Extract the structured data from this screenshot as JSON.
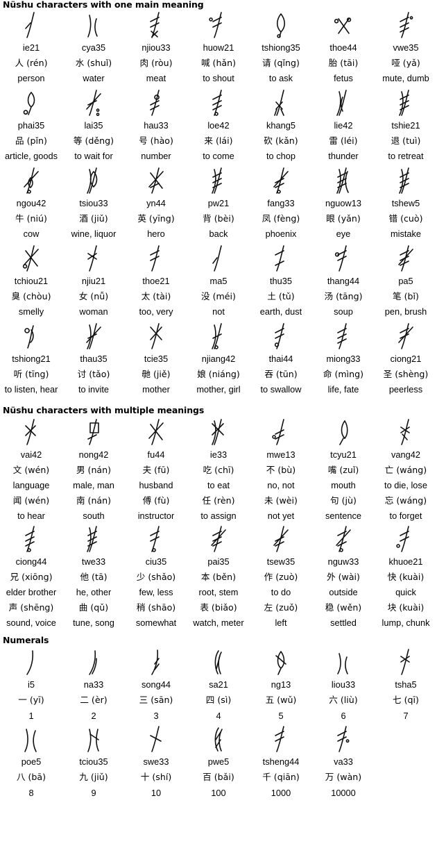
{
  "sections": [
    {
      "id": "one-meaning",
      "title": "Nüshu characters with one main meaning",
      "rows_per_entry": [
        "romanization",
        "hanzi",
        "meaning"
      ],
      "entries": [
        {
          "glyph": "nushu-glyph-ie21",
          "romanization": "ie21",
          "hanzi": "人 (rén)",
          "meaning": "person"
        },
        {
          "glyph": "nushu-glyph-cya35",
          "romanization": "cya35",
          "hanzi": "水 (shuǐ)",
          "meaning": "water"
        },
        {
          "glyph": "nushu-glyph-njiou33",
          "romanization": "njiou33",
          "hanzi": "肉 (ròu)",
          "meaning": "meat"
        },
        {
          "glyph": "nushu-glyph-huow21",
          "romanization": "huow21",
          "hanzi": "喊 (hǎn)",
          "meaning": "to shout"
        },
        {
          "glyph": "nushu-glyph-tshiong35",
          "romanization": "tshiong35",
          "hanzi": "请 (qǐng)",
          "meaning": "to ask"
        },
        {
          "glyph": "nushu-glyph-thoe44",
          "romanization": "thoe44",
          "hanzi": "胎 (tāi)",
          "meaning": "fetus"
        },
        {
          "glyph": "nushu-glyph-vwe35",
          "romanization": "vwe35",
          "hanzi": "哑 (yǎ)",
          "meaning": "mute, dumb"
        },
        {
          "glyph": "nushu-glyph-phai35",
          "romanization": "phai35",
          "hanzi": "品 (pǐn)",
          "meaning": "article, goods"
        },
        {
          "glyph": "nushu-glyph-lai35",
          "romanization": "lai35",
          "hanzi": "等 (děng)",
          "meaning": "to wait for"
        },
        {
          "glyph": "nushu-glyph-hau33",
          "romanization": "hau33",
          "hanzi": "号 (hào)",
          "meaning": "number"
        },
        {
          "glyph": "nushu-glyph-loe42",
          "romanization": "loe42",
          "hanzi": "来 (lái)",
          "meaning": "to come"
        },
        {
          "glyph": "nushu-glyph-khang5",
          "romanization": "khang5",
          "hanzi": "砍 (kǎn)",
          "meaning": "to chop"
        },
        {
          "glyph": "nushu-glyph-lie42",
          "romanization": "lie42",
          "hanzi": "雷 (léi)",
          "meaning": "thunder"
        },
        {
          "glyph": "nushu-glyph-tshie21",
          "romanization": "tshie21",
          "hanzi": "退 (tuì)",
          "meaning": "to retreat"
        },
        {
          "glyph": "nushu-glyph-ngou42",
          "romanization": "ngou42",
          "hanzi": "牛 (niú)",
          "meaning": "cow"
        },
        {
          "glyph": "nushu-glyph-tsiou33",
          "romanization": "tsiou33",
          "hanzi": "酒 (jiǔ)",
          "meaning": "wine, liquor"
        },
        {
          "glyph": "nushu-glyph-yn44",
          "romanization": "yn44",
          "hanzi": "英 (yīng)",
          "meaning": "hero"
        },
        {
          "glyph": "nushu-glyph-pw21",
          "romanization": "pw21",
          "hanzi": "背 (bèi)",
          "meaning": "back"
        },
        {
          "glyph": "nushu-glyph-fang33",
          "romanization": "fang33",
          "hanzi": "凤 (fèng)",
          "meaning": "phoenix"
        },
        {
          "glyph": "nushu-glyph-nguow13",
          "romanization": "nguow13",
          "hanzi": "眼 (yǎn)",
          "meaning": "eye"
        },
        {
          "glyph": "nushu-glyph-tshew5",
          "romanization": "tshew5",
          "hanzi": "错 (cuò)",
          "meaning": "mistake"
        },
        {
          "glyph": "nushu-glyph-tchiou21",
          "romanization": "tchiou21",
          "hanzi": "臭 (chòu)",
          "meaning": "smelly"
        },
        {
          "glyph": "nushu-glyph-njiu21",
          "romanization": "njiu21",
          "hanzi": "女 (nǚ)",
          "meaning": "woman"
        },
        {
          "glyph": "nushu-glyph-thoe21",
          "romanization": "thoe21",
          "hanzi": "太 (tài)",
          "meaning": "too, very"
        },
        {
          "glyph": "nushu-glyph-ma5",
          "romanization": "ma5",
          "hanzi": "没 (méi)",
          "meaning": "not"
        },
        {
          "glyph": "nushu-glyph-thu35",
          "romanization": "thu35",
          "hanzi": "土 (tǔ)",
          "meaning": "earth, dust"
        },
        {
          "glyph": "nushu-glyph-thang44",
          "romanization": "thang44",
          "hanzi": "汤 (tāng)",
          "meaning": "soup"
        },
        {
          "glyph": "nushu-glyph-pa5",
          "romanization": "pa5",
          "hanzi": "笔 (bǐ)",
          "meaning": "pen, brush"
        },
        {
          "glyph": "nushu-glyph-tshiong21",
          "romanization": "tshiong21",
          "hanzi": "听 (tīng)",
          "meaning": "to listen, hear"
        },
        {
          "glyph": "nushu-glyph-thau35",
          "romanization": "thau35",
          "hanzi": "讨 (tǎo)",
          "meaning": "to invite"
        },
        {
          "glyph": "nushu-glyph-tcie35",
          "romanization": "tcie35",
          "hanzi": "毑 (jiě)",
          "meaning": "mother"
        },
        {
          "glyph": "nushu-glyph-njiang42",
          "romanization": "njiang42",
          "hanzi": "娘 (niáng)",
          "meaning": "mother, girl"
        },
        {
          "glyph": "nushu-glyph-thai44",
          "romanization": "thai44",
          "hanzi": "吞 (tūn)",
          "meaning": "to swallow"
        },
        {
          "glyph": "nushu-glyph-miong33",
          "romanization": "miong33",
          "hanzi": "命 (mìng)",
          "meaning": "life, fate"
        },
        {
          "glyph": "nushu-glyph-ciong21",
          "romanization": "ciong21",
          "hanzi": "圣 (shèng)",
          "meaning": "peerless"
        }
      ]
    },
    {
      "id": "multiple-meanings",
      "title": "Nüshu characters with multiple meanings",
      "rows_per_entry": [
        "romanization",
        "hanzi1",
        "meaning1",
        "hanzi2",
        "meaning2"
      ],
      "entries": [
        {
          "glyph": "nushu-glyph-vai42",
          "romanization": "vai42",
          "hanzi1": "文 (wén)",
          "meaning1": "language",
          "hanzi2": "闻 (wén)",
          "meaning2": "to hear"
        },
        {
          "glyph": "nushu-glyph-nong42",
          "romanization": "nong42",
          "hanzi1": "男 (nán)",
          "meaning1": "male, man",
          "hanzi2": "南 (nán)",
          "meaning2": "south"
        },
        {
          "glyph": "nushu-glyph-fu44",
          "romanization": "fu44",
          "hanzi1": "夫 (fū)",
          "meaning1": "husband",
          "hanzi2": "傅 (fù)",
          "meaning2": "instructor"
        },
        {
          "glyph": "nushu-glyph-ie33",
          "romanization": "ie33",
          "hanzi1": "吃 (chī)",
          "meaning1": "to eat",
          "hanzi2": "任 (rèn)",
          "meaning2": "to assign"
        },
        {
          "glyph": "nushu-glyph-mwe13",
          "romanization": "mwe13",
          "hanzi1": "不 (bù)",
          "meaning1": "no, not",
          "hanzi2": "未 (wèi)",
          "meaning2": "not yet"
        },
        {
          "glyph": "nushu-glyph-tcyu21",
          "romanization": "tcyu21",
          "hanzi1": "嘴 (zuǐ)",
          "meaning1": "mouth",
          "hanzi2": "句 (jù)",
          "meaning2": "sentence"
        },
        {
          "glyph": "nushu-glyph-vang42",
          "romanization": "vang42",
          "hanzi1": "亡 (wáng)",
          "meaning1": "to die, lose",
          "hanzi2": "忘 (wáng)",
          "meaning2": "to forget"
        },
        {
          "glyph": "nushu-glyph-ciong44",
          "romanization": "ciong44",
          "hanzi1": "兄 (xiōng)",
          "meaning1": "elder brother",
          "hanzi2": "声 (shēng)",
          "meaning2": "sound, voice"
        },
        {
          "glyph": "nushu-glyph-twe33",
          "romanization": "twe33",
          "hanzi1": "他 (tā)",
          "meaning1": "he, other",
          "hanzi2": "曲 (qǔ)",
          "meaning2": "tune, song"
        },
        {
          "glyph": "nushu-glyph-ciu35",
          "romanization": "ciu35",
          "hanzi1": "少 (shǎo)",
          "meaning1": "few, less",
          "hanzi2": "稍 (shāo)",
          "meaning2": "somewhat"
        },
        {
          "glyph": "nushu-glyph-pai35",
          "romanization": "pai35",
          "hanzi1": "本 (běn)",
          "meaning1": "root, stem",
          "hanzi2": "表 (biǎo)",
          "meaning2": "watch, meter"
        },
        {
          "glyph": "nushu-glyph-tsew35",
          "romanization": "tsew35",
          "hanzi1": "作 (zuò)",
          "meaning1": "to do",
          "hanzi2": "左 (zuǒ)",
          "meaning2": "left"
        },
        {
          "glyph": "nushu-glyph-nguw33",
          "romanization": "nguw33",
          "hanzi1": "外 (wài)",
          "meaning1": "outside",
          "hanzi2": "稳 (wěn)",
          "meaning2": "settled"
        },
        {
          "glyph": "nushu-glyph-khuoe21",
          "romanization": "khuoe21",
          "hanzi1": "快 (kuài)",
          "meaning1": "quick",
          "hanzi2": "块 (kuài)",
          "meaning2": "lump, chunk"
        }
      ]
    },
    {
      "id": "numerals",
      "title": "Numerals",
      "rows_per_entry": [
        "romanization",
        "hanzi",
        "value"
      ],
      "entries": [
        {
          "glyph": "nushu-glyph-i5",
          "romanization": "i5",
          "hanzi": "一 (yī)",
          "value": "1"
        },
        {
          "glyph": "nushu-glyph-na33",
          "romanization": "na33",
          "hanzi": "二 (èr)",
          "value": "2"
        },
        {
          "glyph": "nushu-glyph-song44",
          "romanization": "song44",
          "hanzi": "三 (sān)",
          "value": "3"
        },
        {
          "glyph": "nushu-glyph-sa21",
          "romanization": "sa21",
          "hanzi": "四 (sì)",
          "value": "4"
        },
        {
          "glyph": "nushu-glyph-ng13",
          "romanization": "ng13",
          "hanzi": "五 (wǔ)",
          "value": "5"
        },
        {
          "glyph": "nushu-glyph-liou33",
          "romanization": "liou33",
          "hanzi": "六 (liù)",
          "value": "6"
        },
        {
          "glyph": "nushu-glyph-tsha5",
          "romanization": "tsha5",
          "hanzi": "七 (qī)",
          "value": "7"
        },
        {
          "glyph": "nushu-glyph-poe5",
          "romanization": "poe5",
          "hanzi": "八 (bā)",
          "value": "8"
        },
        {
          "glyph": "nushu-glyph-tciou35",
          "romanization": "tciou35",
          "hanzi": "九 (jiǔ)",
          "value": "9"
        },
        {
          "glyph": "nushu-glyph-swe33",
          "romanization": "swe33",
          "hanzi": "十 (shí)",
          "value": "10"
        },
        {
          "glyph": "nushu-glyph-pwe5",
          "romanization": "pwe5",
          "hanzi": "百 (bǎi)",
          "value": "100"
        },
        {
          "glyph": "nushu-glyph-tsheng44",
          "romanization": "tsheng44",
          "hanzi": "千 (qiān)",
          "value": "1000"
        },
        {
          "glyph": "nushu-glyph-va33",
          "romanization": "va33",
          "hanzi": "万 (wàn)",
          "value": "10000"
        }
      ]
    }
  ],
  "colors": {
    "text": "#000000",
    "background": "#ffffff"
  }
}
